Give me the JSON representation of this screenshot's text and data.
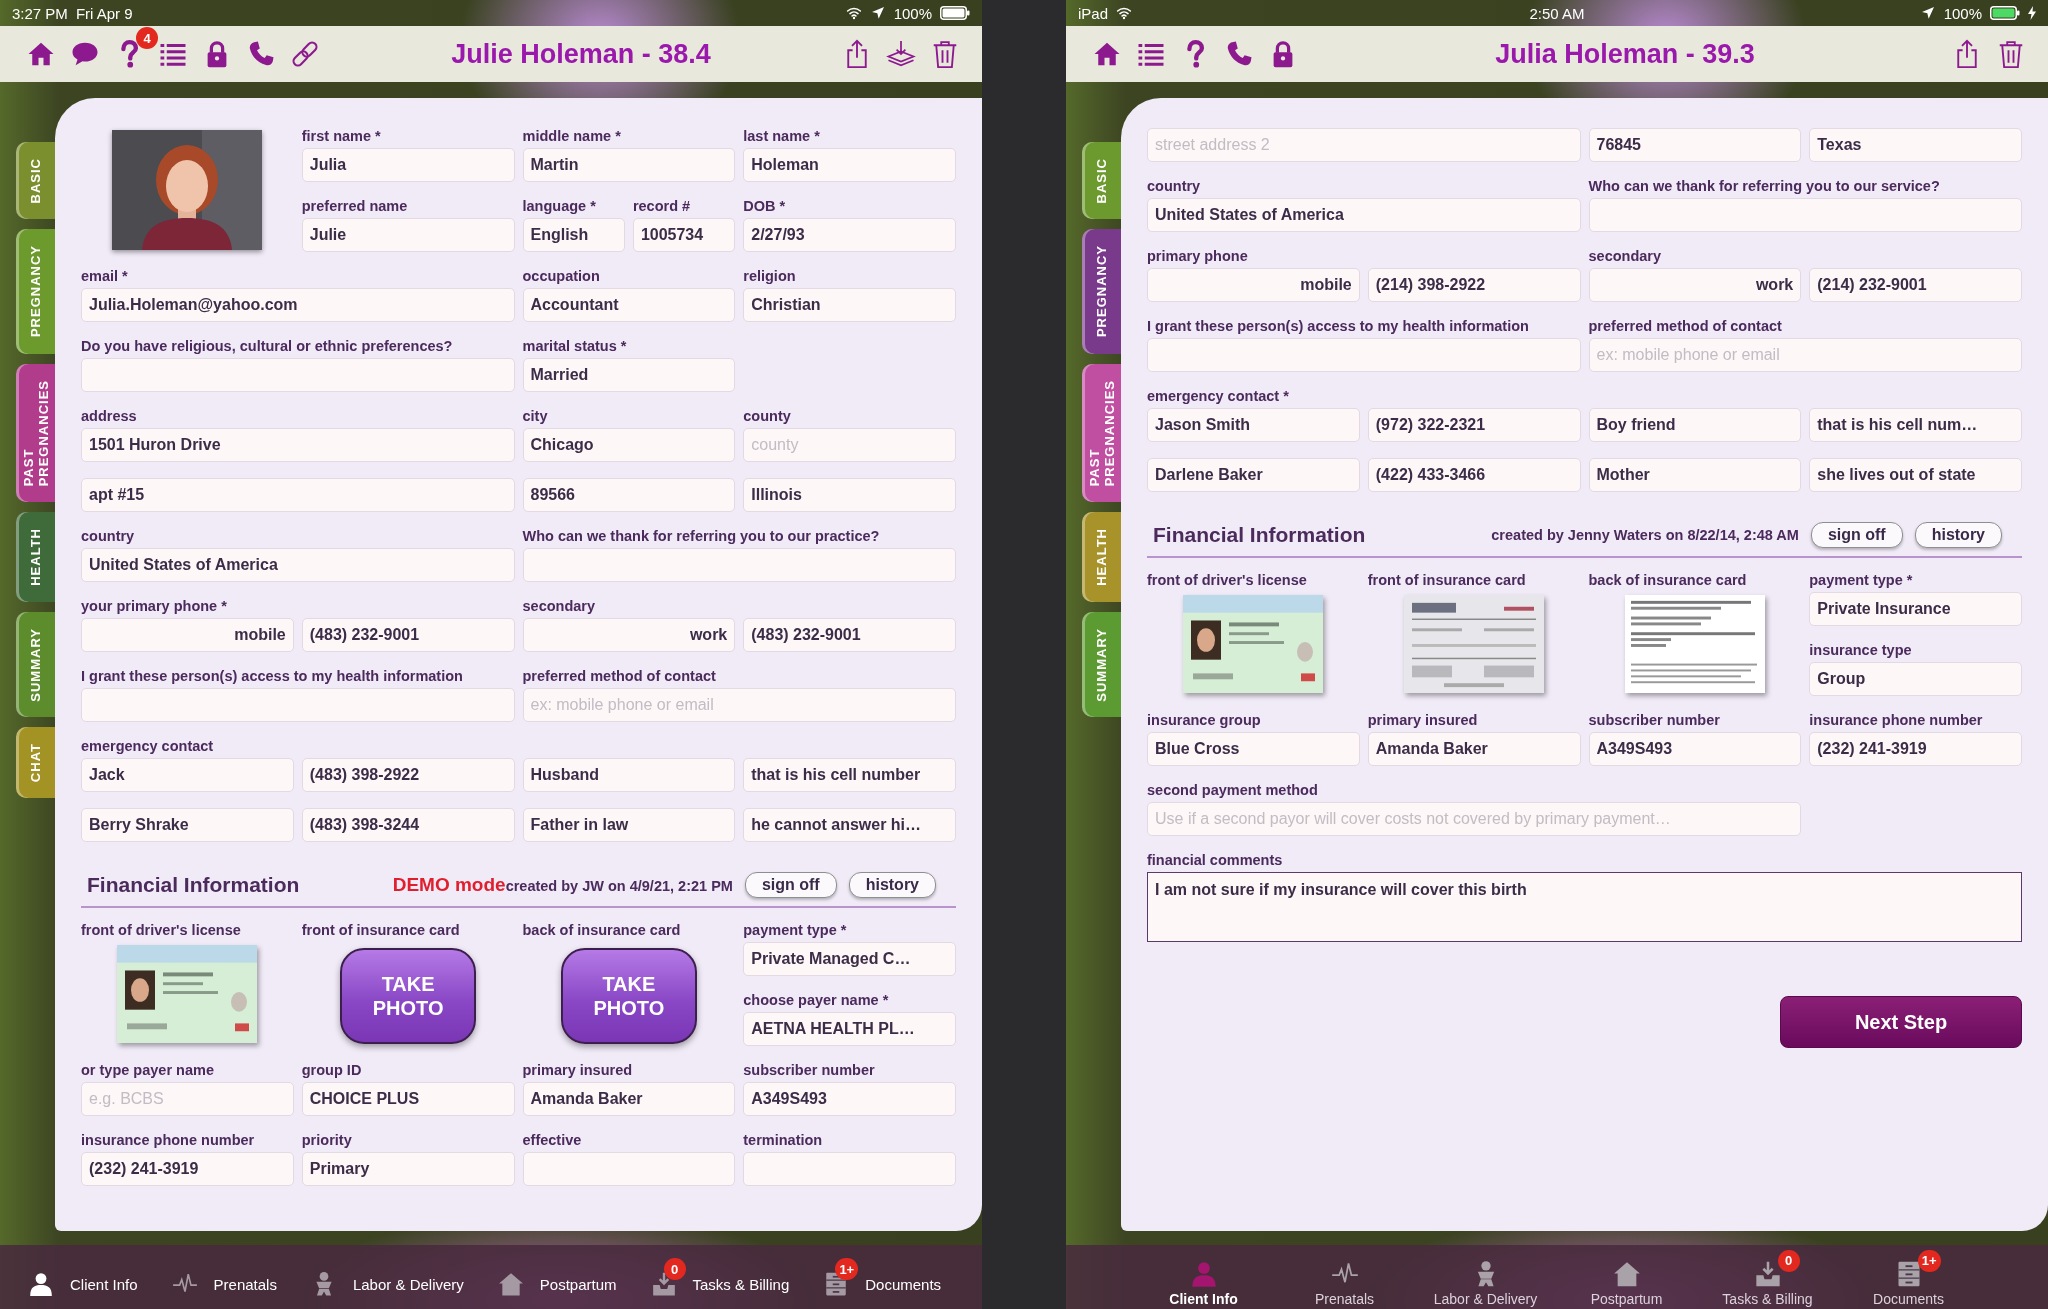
{
  "screens": [
    {
      "status_bar": {
        "left": [
          {
            "kind": "text",
            "text": "3:27 PM"
          },
          {
            "kind": "text",
            "text": "Fri Apr 9"
          }
        ],
        "right": [
          {
            "kind": "wifi"
          },
          {
            "kind": "location"
          },
          {
            "kind": "text",
            "text": "100%"
          },
          {
            "kind": "battery",
            "charging": false
          }
        ]
      },
      "toolbar": {
        "left_icons": [
          {
            "kind": "home"
          },
          {
            "kind": "chat"
          },
          {
            "kind": "help",
            "badge": "4"
          },
          {
            "kind": "list"
          },
          {
            "kind": "lock"
          },
          {
            "kind": "phone"
          },
          {
            "kind": "link"
          }
        ],
        "title": "Julie Holeman - 38.4",
        "right_icons": [
          {
            "kind": "share"
          },
          {
            "kind": "import"
          },
          {
            "kind": "trash"
          }
        ]
      },
      "side_tabs": [
        {
          "label": "BASIC",
          "color": "#7c8f2e"
        },
        {
          "label": "PREGNANCY",
          "color": "#6c9a2c"
        },
        {
          "label": "PAST PREGNANCIES",
          "color": "#b23c8c"
        },
        {
          "label": "HEALTH",
          "color": "#3f6b3a"
        },
        {
          "label": "SUMMARY",
          "color": "#5d8c2c"
        },
        {
          "label": "CHAT",
          "color": "#a39224"
        }
      ],
      "basic_fields": [
        {
          "kind": "picture"
        },
        {
          "kind": "field",
          "label": "first name *",
          "value": "Julia"
        },
        {
          "kind": "field",
          "label": "middle name *",
          "value": "Martin"
        },
        {
          "kind": "field",
          "label": "last name *",
          "value": "Holeman"
        },
        {
          "kind": "field",
          "label": "preferred name",
          "value": "Julie"
        },
        {
          "kind": "narrow",
          "label": "language *",
          "value": "English"
        },
        {
          "kind": "narrow",
          "label": "record #",
          "value": "1005734"
        },
        {
          "kind": "field",
          "label": "DOB *",
          "value": "2/27/93"
        },
        {
          "kind": "wide",
          "label": "email *",
          "value": "Julia.Holeman@yahoo.com"
        },
        {
          "kind": "field",
          "label": "occupation",
          "value": "Accountant"
        },
        {
          "kind": "field",
          "label": "religion",
          "value": "Christian"
        },
        {
          "kind": "wide",
          "label": "Do you have religious, cultural or ethnic preferences?"
        },
        {
          "kind": "field",
          "label": "marital status *",
          "value": "Married"
        },
        {
          "kind": "wide",
          "label": "address",
          "value": "1501 Huron Drive"
        },
        {
          "kind": "field",
          "label": "city",
          "value": "Chicago"
        },
        {
          "kind": "field",
          "label": "county",
          "placeholder": "county"
        },
        {
          "kind": "wide",
          "value": "apt #15"
        },
        {
          "kind": "field",
          "value": "89566"
        },
        {
          "kind": "field",
          "value": "Illinois"
        },
        {
          "kind": "wide",
          "label": "country",
          "value": "United States of America"
        },
        {
          "kind": "wide",
          "label": "Who can we thank for referring you to our practice?"
        },
        {
          "kind": "type",
          "label": "your primary phone *",
          "value": "mobile"
        },
        {
          "kind": "field",
          "value": "(483) 232-9001"
        },
        {
          "kind": "type",
          "label": "secondary",
          "value": "work"
        },
        {
          "kind": "field",
          "value": "(483) 232-9001"
        },
        {
          "kind": "wide",
          "label": "I grant these person(s) access to my health information"
        },
        {
          "kind": "wide",
          "label": "preferred method of contact",
          "placeholder": "ex: mobile phone or email"
        },
        {
          "kind": "field",
          "label": "emergency contact",
          "value": "Jack"
        },
        {
          "kind": "field",
          "value": "(483) 398-2922"
        },
        {
          "kind": "field",
          "value": "Husband"
        },
        {
          "kind": "field",
          "value": "that is his cell number"
        },
        {
          "kind": "field",
          "value": "Berry Shrake"
        },
        {
          "kind": "field",
          "value": "(483) 398-3244"
        },
        {
          "kind": "field",
          "value": "Father in law"
        },
        {
          "kind": "field",
          "value": "he cannot answer hi…"
        }
      ],
      "financial": {
        "title": "Financial Information",
        "demo_label": "DEMO mode",
        "created": "created by JW on 4/9/21, 2:21 PM",
        "buttons": [
          "sign off",
          "history"
        ],
        "fields": [
          {
            "kind": "picture",
            "label": "front of driver's license"
          },
          {
            "kind": "photo_button",
            "label": "front of insurance card",
            "text": "TAKE PHOTO"
          },
          {
            "kind": "photo_button",
            "label": "back of insurance card",
            "text": "TAKE PHOTO"
          },
          {
            "kind": "field",
            "label": "payment type *",
            "value": "Private Managed C…"
          },
          {
            "kind": "field",
            "label": "choose payer name *",
            "value": "AETNA HEALTH PL…"
          },
          {
            "kind": "field",
            "label": "or type payer name",
            "placeholder": "e.g. BCBS"
          },
          {
            "kind": "field",
            "label": "group ID",
            "value": "CHOICE PLUS"
          },
          {
            "kind": "field",
            "label": "primary insured",
            "value": "Amanda Baker"
          },
          {
            "kind": "field",
            "label": "subscriber number",
            "value": "A349S493"
          },
          {
            "kind": "field",
            "label": "insurance phone number",
            "value": "(232) 241-3919"
          },
          {
            "kind": "field",
            "label": "priority",
            "value": "Primary"
          },
          {
            "kind": "field",
            "label": "effective"
          },
          {
            "kind": "field",
            "label": "termination"
          }
        ]
      },
      "tab_bar": {
        "kind": "inline",
        "items": [
          {
            "label": "Client Info",
            "selected": true
          },
          {
            "label": "Prenatals",
            "selected": false
          },
          {
            "label": "Labor & Delivery",
            "selected": false
          },
          {
            "label": "Postpartum",
            "selected": false
          },
          {
            "label": "Tasks & Billing",
            "selected": false,
            "badge": "0"
          },
          {
            "label": "Documents",
            "selected": false,
            "badge": "1+"
          }
        ]
      }
    },
    {
      "status_bar": {
        "left": [
          {
            "kind": "text",
            "text": "iPad"
          },
          {
            "kind": "wifi"
          }
        ],
        "center": [
          {
            "kind": "text",
            "text": "2:50 AM"
          }
        ],
        "right": [
          {
            "kind": "location"
          },
          {
            "kind": "text",
            "text": "100%"
          },
          {
            "kind": "battery",
            "charging": true
          }
        ]
      },
      "toolbar": {
        "left_icons": [
          {
            "kind": "home"
          },
          {
            "kind": "list"
          },
          {
            "kind": "help"
          },
          {
            "kind": "phone"
          },
          {
            "kind": "lock"
          }
        ],
        "title": "Julia Holeman - 39.3",
        "right_icons": [
          {
            "kind": "share"
          },
          {
            "kind": "trash"
          }
        ]
      },
      "side_tabs": [
        {
          "label": "BASIC",
          "color": "#6d9a2e"
        },
        {
          "label": "PREGNANCY",
          "color": "#7a3a8c"
        },
        {
          "label": "PAST PREGNANCIES",
          "color": "#c04fa2"
        },
        {
          "label": "HEALTH",
          "color": "#a8922a"
        },
        {
          "label": "SUMMARY",
          "color": "#5c9a32"
        }
      ],
      "basic_fields": [
        {
          "kind": "wide",
          "placeholder": "street address 2"
        },
        {
          "kind": "field",
          "value": "76845"
        },
        {
          "kind": "field",
          "value": "Texas"
        },
        {
          "kind": "wide",
          "label": "country",
          "value": "United States of America"
        },
        {
          "kind": "wide",
          "label": "Who can we thank for referring you to our service?"
        },
        {
          "kind": "type",
          "label": "primary phone",
          "value": "mobile"
        },
        {
          "kind": "field",
          "value": "(214) 398-2922"
        },
        {
          "kind": "type",
          "label": "secondary",
          "value": "work"
        },
        {
          "kind": "field",
          "value": "(214) 232-9001"
        },
        {
          "kind": "wide",
          "label": "I grant these person(s) access to my health information"
        },
        {
          "kind": "wide",
          "label": "preferred method of contact",
          "placeholder": "ex: mobile phone or email"
        },
        {
          "kind": "field",
          "label": "emergency contact *",
          "value": "Jason Smith"
        },
        {
          "kind": "field",
          "value": "(972) 322-2321"
        },
        {
          "kind": "field",
          "value": "Boy friend"
        },
        {
          "kind": "field",
          "value": "that is his cell num…"
        },
        {
          "kind": "field",
          "value": "Darlene Baker"
        },
        {
          "kind": "field",
          "value": "(422) 433-3466"
        },
        {
          "kind": "field",
          "value": "Mother"
        },
        {
          "kind": "field",
          "value": "she lives out of state"
        }
      ],
      "financial": {
        "title": "Financial Information",
        "created": "created by Jenny Waters on 8/22/14, 2:48 AM",
        "buttons": [
          "sign off",
          "history"
        ],
        "fields": [
          {
            "kind": "picture",
            "label": "front of driver's license"
          },
          {
            "kind": "picture",
            "label": "front of insurance card"
          },
          {
            "kind": "picture",
            "label": "back of insurance card"
          },
          {
            "kind": "field",
            "label": "payment type *",
            "value": "Private Insurance"
          },
          {
            "kind": "field",
            "label": "insurance type",
            "value": "Group"
          },
          {
            "kind": "field",
            "label": "insurance group",
            "value": "Blue Cross"
          },
          {
            "kind": "field",
            "label": "primary insured",
            "value": "Amanda Baker"
          },
          {
            "kind": "field",
            "label": "subscriber number",
            "value": "A349S493"
          },
          {
            "kind": "field",
            "label": "insurance phone number",
            "value": "(232) 241-3919"
          },
          {
            "kind": "extra_wide",
            "label": "second payment method",
            "placeholder": "Use if a second payor will cover costs not covered by primary payment…"
          },
          {
            "kind": "textarea",
            "label": "financial comments",
            "value": "I am not sure if my insurance will cover this birth"
          }
        ]
      },
      "next_button": "Next Step",
      "tab_bar": {
        "kind": "stacked",
        "items": [
          {
            "label": "Client Info",
            "selected": true
          },
          {
            "label": "Prenatals",
            "selected": false
          },
          {
            "label": "Labor & Delivery",
            "selected": false
          },
          {
            "label": "Postpartum",
            "selected": false
          },
          {
            "label": "Tasks & Billing",
            "selected": false,
            "badge": "0"
          },
          {
            "label": "Documents",
            "selected": false,
            "badge": "1+"
          }
        ]
      }
    }
  ]
}
